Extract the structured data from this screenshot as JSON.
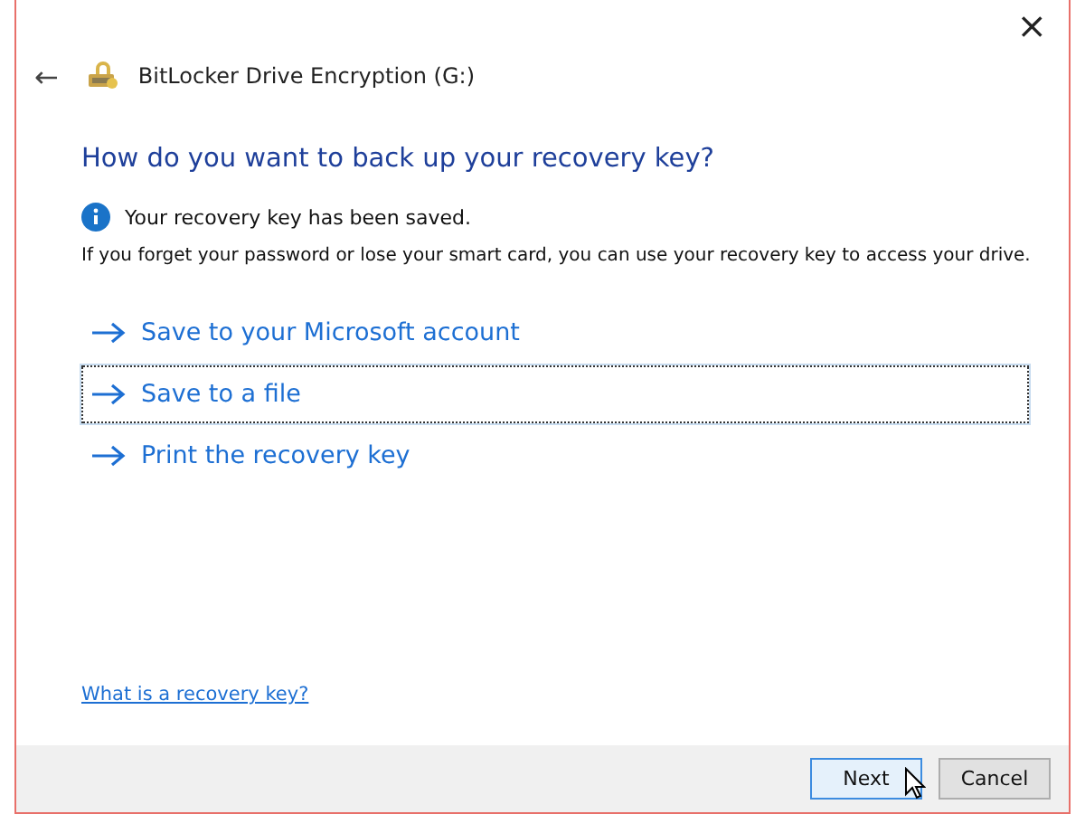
{
  "window": {
    "title": "BitLocker Drive Encryption (G:)",
    "close": "×",
    "back": "←"
  },
  "heading": "How do you want to back up your recovery key?",
  "info": "Your recovery key has been saved.",
  "description": "If you forget your password or lose your smart card, you can use your recovery key to access your drive.",
  "options": [
    {
      "label": "Save to your Microsoft account",
      "selected": false
    },
    {
      "label": "Save to a file",
      "selected": true
    },
    {
      "label": "Print the recovery key",
      "selected": false
    }
  ],
  "help_link": "What is a recovery key?",
  "buttons": [
    {
      "label": "Next",
      "default": true
    },
    {
      "label": "Cancel",
      "default": false
    }
  ]
}
